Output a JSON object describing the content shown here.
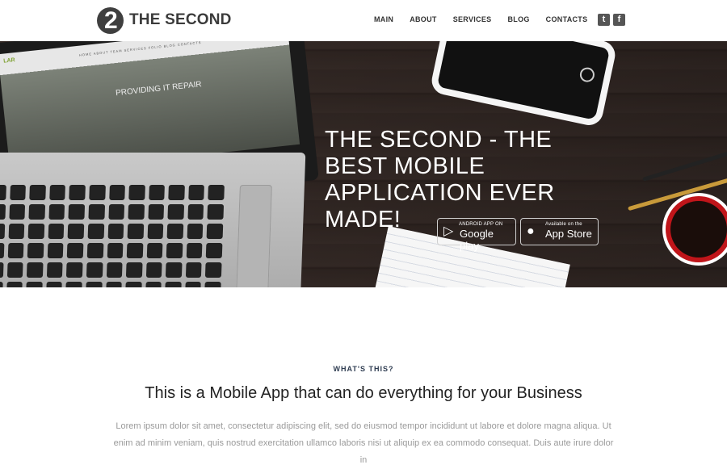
{
  "brand": {
    "name": "THE SECOND",
    "mark": "2"
  },
  "nav": [
    {
      "label": "MAIN"
    },
    {
      "label": "ABOUT"
    },
    {
      "label": "SERVICES"
    },
    {
      "label": "BLOG"
    },
    {
      "label": "CONTACTS"
    }
  ],
  "social": [
    {
      "icon": "twitter-icon",
      "glyph": "t"
    },
    {
      "icon": "facebook-icon",
      "glyph": "f"
    }
  ],
  "hero": {
    "title": "THE SECOND - THE BEST MOBILE APPLICATION EVER MADE!",
    "google_play": {
      "small": "ANDROID APP ON",
      "big": "Google play",
      "icon": "play-icon"
    },
    "app_store": {
      "small": "Available on the",
      "big": "App Store",
      "icon": "apple-icon"
    }
  },
  "laptop_screen": {
    "brand": "LAR",
    "nav": "HOME ABOUT TEAM SERVICES FOLIO BLOG CONTACTS",
    "heading": "PROVIDING IT REPAIR"
  },
  "section": {
    "eyebrow": "WHAT'S THIS?",
    "title": "This is a Mobile App that can do everything for your Business",
    "body": "Lorem ipsum dolor sit amet, consectetur adipiscing elit, sed do eiusmod tempor incididunt ut labore et dolore magna aliqua. Ut enim ad minim veniam, quis nostrud exercitation ullamco laboris nisi ut aliquip ex ea commodo consequat. Duis aute irure dolor in"
  }
}
